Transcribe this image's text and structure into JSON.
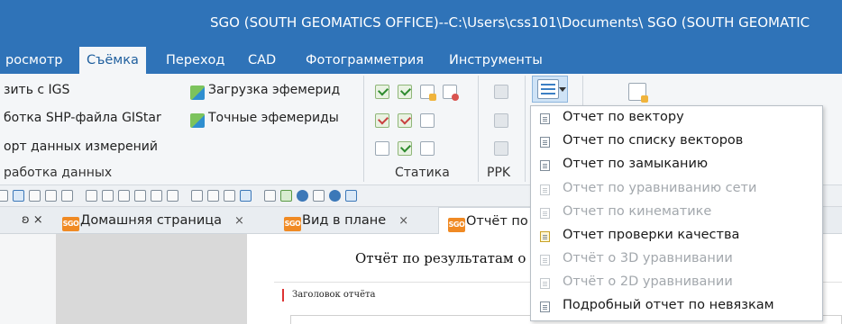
{
  "window": {
    "title": "SGO (SOUTH GEOMATICS OFFICE)--C:\\Users\\css101\\Documents\\ SGO (SOUTH GEOMATIC"
  },
  "ribbon_tabs": [
    {
      "label": "росмотр",
      "active": false
    },
    {
      "label": "Съёмка",
      "active": true
    },
    {
      "label": "Переход",
      "active": false
    },
    {
      "label": "CAD",
      "active": false
    },
    {
      "label": "Фотограмметрия",
      "active": false
    },
    {
      "label": "Инструменты",
      "active": false
    }
  ],
  "ribbon": {
    "import_igs": "зить с IGS",
    "process_shp": "ботка SHP-файла GIStar",
    "export_measurements": "орт данных измерений",
    "group_data_processing": "работка данных",
    "load_ephemeris": "Загрузка эфемерид",
    "precise_ephemeris": "Точные эфемериды",
    "group_static": "Статика",
    "group_ppk": "PPK"
  },
  "doc_tabs": [
    {
      "label": "Домашняя страница",
      "badge": "SGO",
      "closable": true,
      "active": false
    },
    {
      "label": "Вид в плане",
      "badge": "SGO",
      "closable": true,
      "active": false
    },
    {
      "label": "Отчёт по с",
      "badge": "SGO",
      "closable": false,
      "active": true
    }
  ],
  "doc_close_glyph": "×",
  "pin_glyph": "ʚ ×",
  "report": {
    "heading": "Отчёт по результатам о",
    "header_label": "Заголовок отчёта"
  },
  "report_menu": {
    "items": [
      {
        "label": "Отчет по вектору",
        "enabled": true,
        "icon": "report-doc-icon"
      },
      {
        "label": "Отчет по списку векторов",
        "enabled": true,
        "icon": "report-doc-icon"
      },
      {
        "label": "Отчет по замыканию",
        "enabled": true,
        "icon": "report-doc-icon"
      },
      {
        "label": "Отчет по уравниванию сети",
        "enabled": false,
        "icon": "report-doc-icon"
      },
      {
        "label": "Отчет по кинематике",
        "enabled": false,
        "icon": "report-doc-icon"
      },
      {
        "label": "Отчет проверки качества",
        "enabled": true,
        "icon": "quality-report-icon"
      },
      {
        "label": "Отчёт о 3D уравнивании",
        "enabled": false,
        "icon": "report-doc-icon"
      },
      {
        "label": "Отчёт о 2D уравнивании",
        "enabled": false,
        "icon": "report-doc-icon"
      },
      {
        "label": "Подробный отчет по невязкам",
        "enabled": true,
        "icon": "report-doc-icon"
      }
    ]
  },
  "colors": {
    "titlebar": "#2f73b8",
    "ribbon_bg": "#f4f6f8",
    "sgo_badge": "#f08a24",
    "disabled_text": "#a3a8ad"
  }
}
